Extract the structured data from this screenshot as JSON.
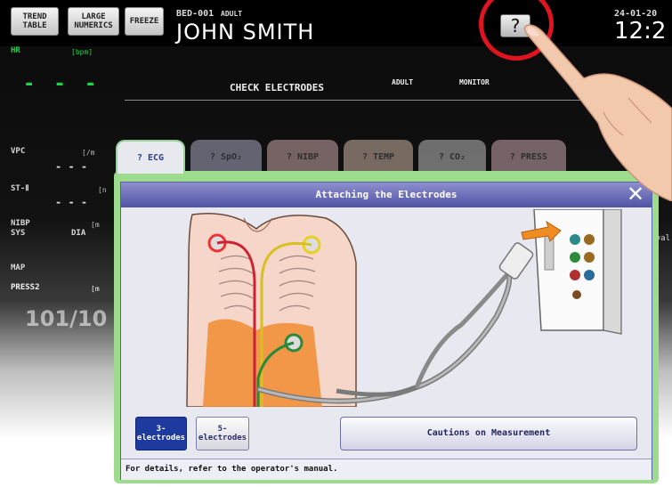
{
  "topbar": {
    "trend_table": "TREND TABLE",
    "large_numerics": "LARGE NUMERICS",
    "freeze": "FREEZE",
    "bed": "BED-001",
    "patient_type": "ADULT",
    "patient_name": "JOHN  SMITH",
    "help": "?",
    "date": "24-01-20",
    "time": "12:2"
  },
  "monitor": {
    "hr_label": "HR",
    "hr_unit": "[bpm]",
    "hr_value": "- - -",
    "status": "CHECK ELECTRODES",
    "mode_adult": "ADULT",
    "mode_monitor": "MONITOR",
    "vpc_label": "VPC",
    "vpc_unit": "[/m",
    "st_label": "ST-Ⅱ",
    "st_unit": "[n",
    "nibp_label": "NIBP",
    "nibp_unit": "[m",
    "sys_label": "SYS",
    "dia_label": "DIA",
    "map_label": "MAP",
    "press_label": "PRESS2",
    "press_unit": "[m",
    "big_value": "101/10",
    "interval_label": "rval",
    "dashes_short": "- - -"
  },
  "help_window": {
    "tabs": [
      "? ECG",
      "? SpO₂",
      "? NIBP",
      "? TEMP",
      "? CO₂",
      "? PRESS"
    ],
    "title": "Attaching the Electrodes",
    "close": "✕",
    "btn_3": "3-\nelectrodes",
    "btn_3_l1": "3-",
    "btn_3_l2": "electrodes",
    "btn_5_l1": "5-",
    "btn_5_l2": "electrodes",
    "cautions": "Cautions on Measurement",
    "footer": "For details, refer to the operator's manual."
  },
  "colors": {
    "accent_ring": "#e0141e",
    "panel_green": "#9cdc8c",
    "title_blue": "#4f53a4",
    "selected_blue": "#1e3a9e",
    "hr_green": "#1fd24a"
  }
}
